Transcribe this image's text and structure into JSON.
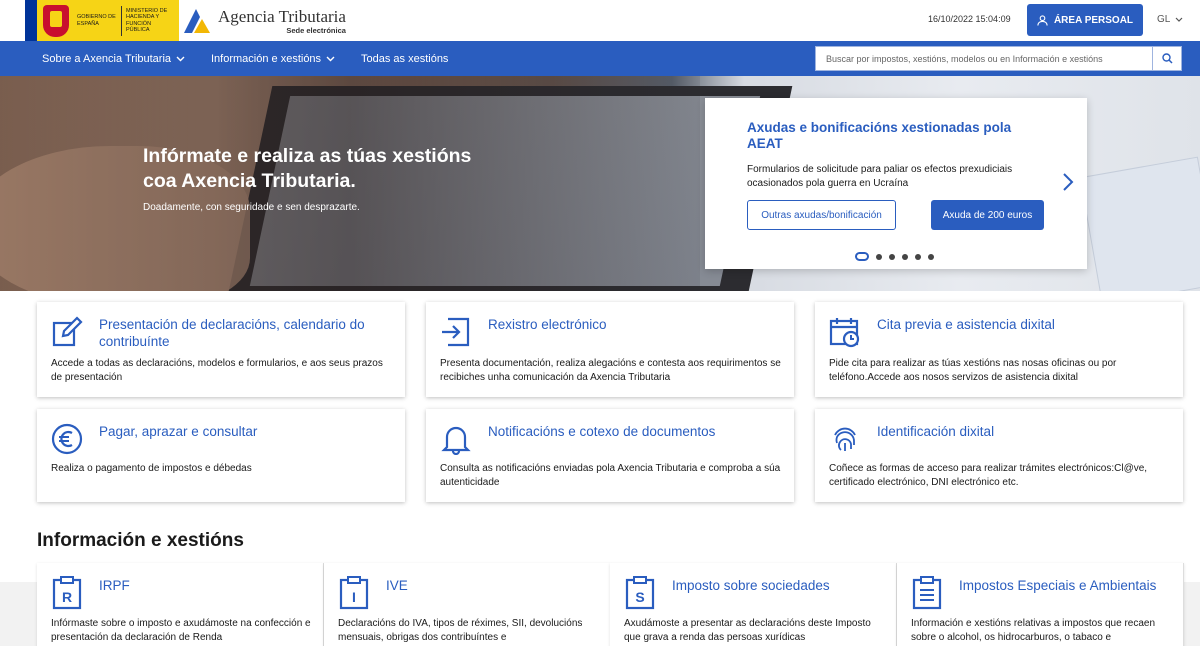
{
  "header": {
    "gob_label": "Gobierno de España",
    "ministry_label": "Ministerio de Hacienda y Función Pública",
    "brand_name": "Agencia Tributaria",
    "brand_sub": "Sede electrónica",
    "datetime": "16/10/2022 15:04:09",
    "area_button": "ÁREA PERSOAL",
    "language": "GL"
  },
  "nav": {
    "items": [
      {
        "label": "Sobre a Axencia Tributaria",
        "has_menu": true
      },
      {
        "label": "Información e xestións",
        "has_menu": true
      },
      {
        "label": "Todas as xestións",
        "has_menu": false
      }
    ],
    "search_placeholder": "Buscar por impostos, xestións, modelos ou en Información e xestións"
  },
  "hero": {
    "title": "Infórmate e realiza as túas xestións coa Axencia Tributaria.",
    "subtitle": "Doadamente, con seguridade e sen desprazarte."
  },
  "promo": {
    "title": "Axudas e bonificacións xestionadas pola AEAT",
    "text": "Formularios de solicitude para paliar os efectos prexudiciais ocasionados pola guerra en Ucraína",
    "button_secondary": "Outras axudas/bonificación",
    "button_primary": "Axuda de 200 euros",
    "slides": 6,
    "active_slide": 1
  },
  "services": [
    {
      "icon": "edit-icon",
      "title": "Presentación de declaracións, calendario do contribuínte",
      "desc": "Accede a todas as declaracións, modelos e formularios, e aos seus prazos de presentación"
    },
    {
      "icon": "register-icon",
      "title": "Rexistro electrónico",
      "desc": "Presenta documentación, realiza alegacións e contesta aos requirimentos se recibiches unha comunicación da Axencia Tributaria"
    },
    {
      "icon": "calendar-clock-icon",
      "title": "Cita previa e asistencia dixital",
      "desc": "Pide cita para realizar as túas xestións nas nosas oficinas ou por teléfono.Accede aos nosos servizos de asistencia dixital"
    },
    {
      "icon": "euro-icon",
      "title": "Pagar, aprazar e consultar",
      "desc": "Realiza o pagamento de impostos e débedas"
    },
    {
      "icon": "bell-icon",
      "title": "Notificacións e cotexo de documentos",
      "desc": "Consulta as notificacións enviadas pola Axencia Tributaria e comproba a súa autenticidade"
    },
    {
      "icon": "fingerprint-icon",
      "title": "Identificación dixital",
      "desc": "Coñece as formas de acceso para realizar trámites electrónicos:Cl@ve, certificado electrónico, DNI electrónico etc."
    }
  ],
  "info_section": {
    "title": "Información e xestións",
    "cards": [
      {
        "icon": "clipboard-r-icon",
        "letter": "R",
        "title": "IRPF",
        "desc": "Infórmaste sobre o imposto e axudámoste na confección e presentación da declaración de Renda"
      },
      {
        "icon": "clipboard-i-icon",
        "letter": "I",
        "title": "IVE",
        "desc": "Declaracións do IVA, tipos de réximes, SII, devolucións mensuais, obrigas dos contribuíntes e"
      },
      {
        "icon": "clipboard-s-icon",
        "letter": "S",
        "title": "Imposto sobre sociedades",
        "desc": "Axudámoste a presentar as declaracións deste Imposto que grava a renda das persoas xurídicas"
      },
      {
        "icon": "clipboard-list-icon",
        "letter": "",
        "title": "Impostos Especiais e Ambientais",
        "desc": "Información e xestións relativas a impostos que recaen sobre o alcohol, os hidrocarburos, o tabaco e"
      }
    ]
  },
  "colors": {
    "primary": "#2a5dbf",
    "gob_yellow": "#f6d416"
  }
}
